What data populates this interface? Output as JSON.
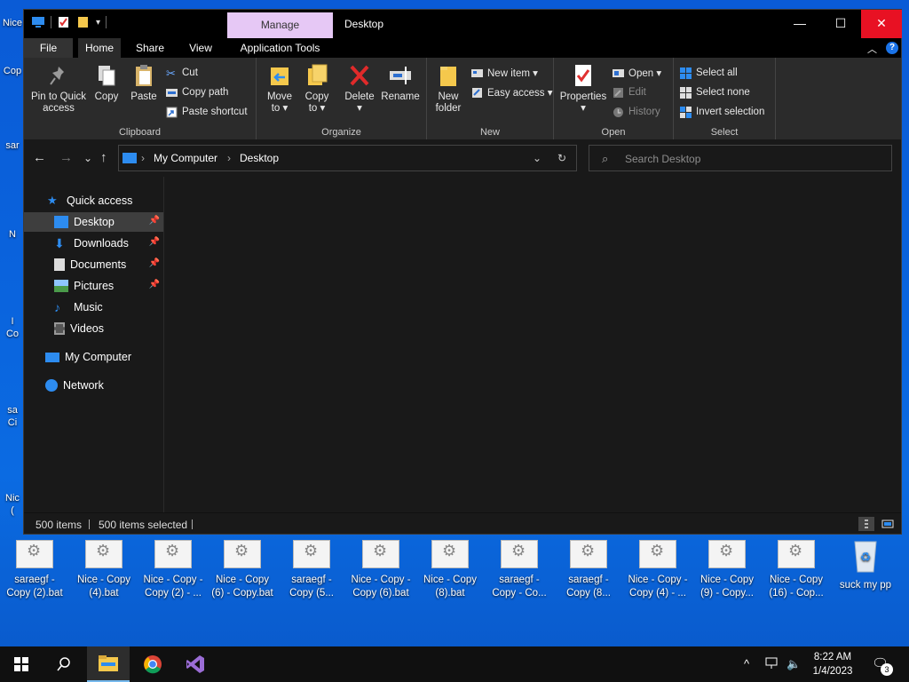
{
  "desktop_left": {
    "items": [
      "Nice",
      "Cop",
      "sar",
      "N",
      "I",
      "Co",
      "sa",
      "Ci",
      "Nic",
      "("
    ]
  },
  "titlebar": {
    "manage_tab": "Manage",
    "title": "Desktop",
    "minimize": "—",
    "maximize": "☐",
    "close": "✕"
  },
  "ribbon_tabs": {
    "file": "File",
    "home": "Home",
    "share": "Share",
    "view": "View",
    "app_tools": "Application Tools"
  },
  "ribbon": {
    "clipboard": {
      "label": "Clipboard",
      "pin_line1": "Pin to Quick",
      "pin_line2": "access",
      "copy": "Copy",
      "paste": "Paste",
      "cut": "Cut",
      "copy_path": "Copy path",
      "paste_shortcut": "Paste shortcut"
    },
    "organize": {
      "label": "Organize",
      "move_line1": "Move",
      "move_line2": "to ▾",
      "copy_line1": "Copy",
      "copy_line2": "to ▾",
      "delete_line1": "Delete",
      "delete_line2": "▾",
      "rename": "Rename"
    },
    "new": {
      "label": "New",
      "new_folder_line1": "New",
      "new_folder_line2": "folder",
      "new_item": "New item ▾",
      "easy_access": "Easy access ▾"
    },
    "open": {
      "label": "Open",
      "properties_line1": "Properties",
      "properties_line2": "▾",
      "open": "Open ▾",
      "edit": "Edit",
      "history": "History"
    },
    "select": {
      "label": "Select",
      "select_all": "Select all",
      "select_none": "Select none",
      "invert_selection": "Invert selection"
    }
  },
  "address": {
    "back": "←",
    "forward": "→",
    "recent": "⌄",
    "up": "↑",
    "crumb_sep": "›",
    "crumbs": [
      "My Computer",
      "Desktop"
    ],
    "dropdown": "⌄",
    "refresh": "↻",
    "search_placeholder": "Search Desktop"
  },
  "nav": {
    "quick_access": "Quick access",
    "desktop": "Desktop",
    "downloads": "Downloads",
    "documents": "Documents",
    "pictures": "Pictures",
    "music": "Music",
    "videos": "Videos",
    "my_computer": "My Computer",
    "network": "Network",
    "pin_glyph": "📌"
  },
  "status": {
    "items": "500 items",
    "selected": "500 items selected"
  },
  "desktop_icons": [
    {
      "line1": "saraegf -",
      "line2": "Copy (2).bat"
    },
    {
      "line1": "Nice - Copy",
      "line2": "(4).bat"
    },
    {
      "line1": "Nice - Copy -",
      "line2": "Copy (2) - ..."
    },
    {
      "line1": "Nice - Copy",
      "line2": "(6) - Copy.bat"
    },
    {
      "line1": "saraegf -",
      "line2": "Copy (5..."
    },
    {
      "line1": "Nice - Copy -",
      "line2": "Copy (6).bat"
    },
    {
      "line1": "Nice - Copy",
      "line2": "(8).bat"
    },
    {
      "line1": "saraegf -",
      "line2": "Copy - Co..."
    },
    {
      "line1": "saraegf -",
      "line2": "Copy (8..."
    },
    {
      "line1": "Nice - Copy -",
      "line2": "Copy (4) - ..."
    },
    {
      "line1": "Nice - Copy",
      "line2": "(9) - Copy..."
    },
    {
      "line1": "Nice - Copy",
      "line2": "(16) - Cop..."
    },
    {
      "line1": "suck my pp",
      "line2": ""
    }
  ],
  "taskbar": {
    "time": "8:22 AM",
    "date": "1/4/2023",
    "notification_count": "3",
    "tray_chevron": "^"
  }
}
